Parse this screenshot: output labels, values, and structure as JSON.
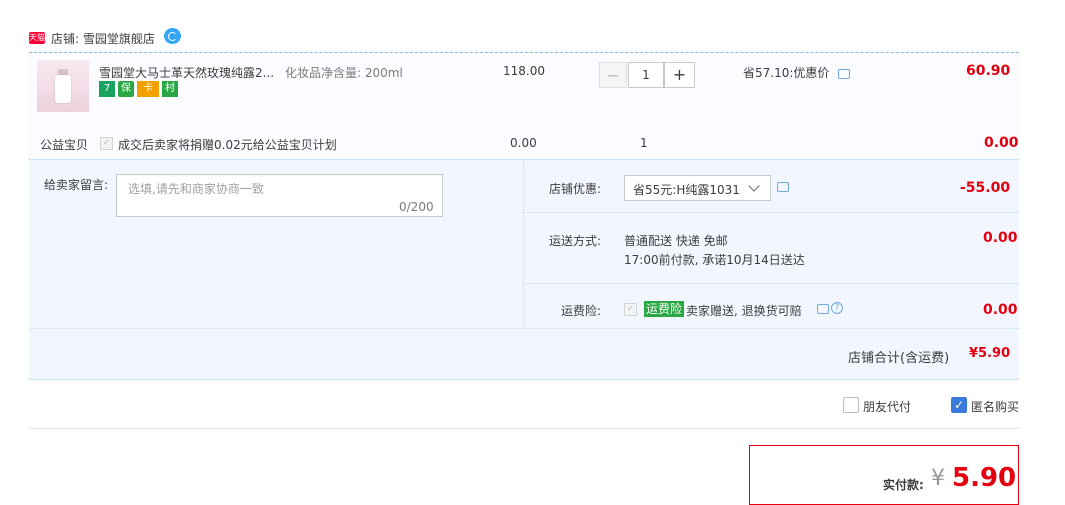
{
  "shop": {
    "badge": "天猫",
    "label": "店铺: 雪园堂旗舰店"
  },
  "item": {
    "title": "雪园堂大马士革天然玫瑰纯露2...",
    "spec": "化妆品净含量: 200ml",
    "service_icons": [
      "7",
      "保",
      "卡",
      "村"
    ],
    "unit_price": "118.00",
    "quantity": "1",
    "qty_minus": "−",
    "qty_plus": "+",
    "promo_text": "省57.10:优惠价",
    "total": "60.90"
  },
  "charity": {
    "label": "公益宝贝",
    "checkbox_mark": "✓",
    "text": "成交后卖家将捐赠0.02元给公益宝贝计划",
    "price": "0.00",
    "quantity": "1",
    "total": "0.00"
  },
  "memo": {
    "label": "给卖家留言:",
    "placeholder": "选填,请先和商家协商一致",
    "count": "0/200"
  },
  "coupon": {
    "label": "店铺优惠:",
    "value": "省55元:H纯露1031",
    "amount": "-55.00"
  },
  "shipping": {
    "label": "运送方式:",
    "line1": "普通配送 快递 免邮",
    "line2": "17:00前付款, 承诺10月14日送达",
    "amount": "0.00"
  },
  "insurance": {
    "label": "运费险:",
    "checkbox_mark": "✓",
    "badge": "运费险",
    "text": "卖家赠送, 退换货可赔",
    "help": "?",
    "amount": "0.00"
  },
  "shop_total": {
    "label": "店铺合计(含运费)",
    "value": "¥5.90"
  },
  "options": {
    "friend_pay": "朋友代付",
    "anonymous": "匿名购买",
    "anonymous_checked": true
  },
  "payment": {
    "label": "实付款:",
    "currency": "¥",
    "amount": "5.90"
  },
  "colors": {
    "price_red": "#e4000f",
    "option_bg": "#f2f7ff",
    "checkbox_blue": "#3a7cdb",
    "badge_green": "#2aa744"
  }
}
